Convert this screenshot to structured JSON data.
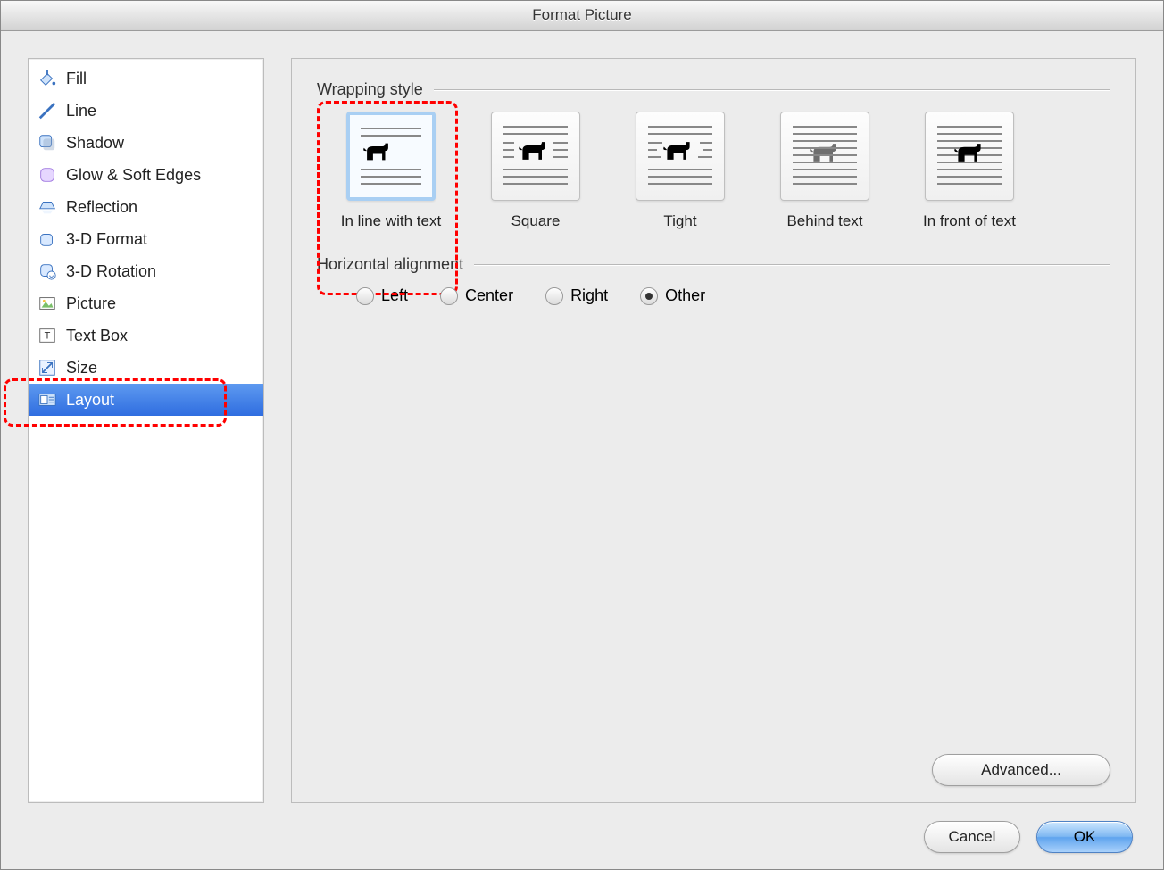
{
  "window": {
    "title": "Format Picture"
  },
  "sidebar": {
    "items": [
      {
        "label": "Fill"
      },
      {
        "label": "Line"
      },
      {
        "label": "Shadow"
      },
      {
        "label": "Glow & Soft Edges"
      },
      {
        "label": "Reflection"
      },
      {
        "label": "3-D Format"
      },
      {
        "label": "3-D Rotation"
      },
      {
        "label": "Picture"
      },
      {
        "label": "Text Box"
      },
      {
        "label": "Size"
      },
      {
        "label": "Layout"
      }
    ],
    "selected_index": 10
  },
  "layout_panel": {
    "wrapping": {
      "title": "Wrapping style",
      "options": [
        {
          "label": "In line with text"
        },
        {
          "label": "Square"
        },
        {
          "label": "Tight"
        },
        {
          "label": "Behind text"
        },
        {
          "label": "In front of text"
        }
      ],
      "selected_index": 0
    },
    "alignment": {
      "title": "Horizontal alignment",
      "options": [
        {
          "label": "Left"
        },
        {
          "label": "Center"
        },
        {
          "label": "Right"
        },
        {
          "label": "Other"
        }
      ],
      "selected_index": 3
    },
    "advanced_label": "Advanced..."
  },
  "buttons": {
    "cancel": "Cancel",
    "ok": "OK"
  }
}
